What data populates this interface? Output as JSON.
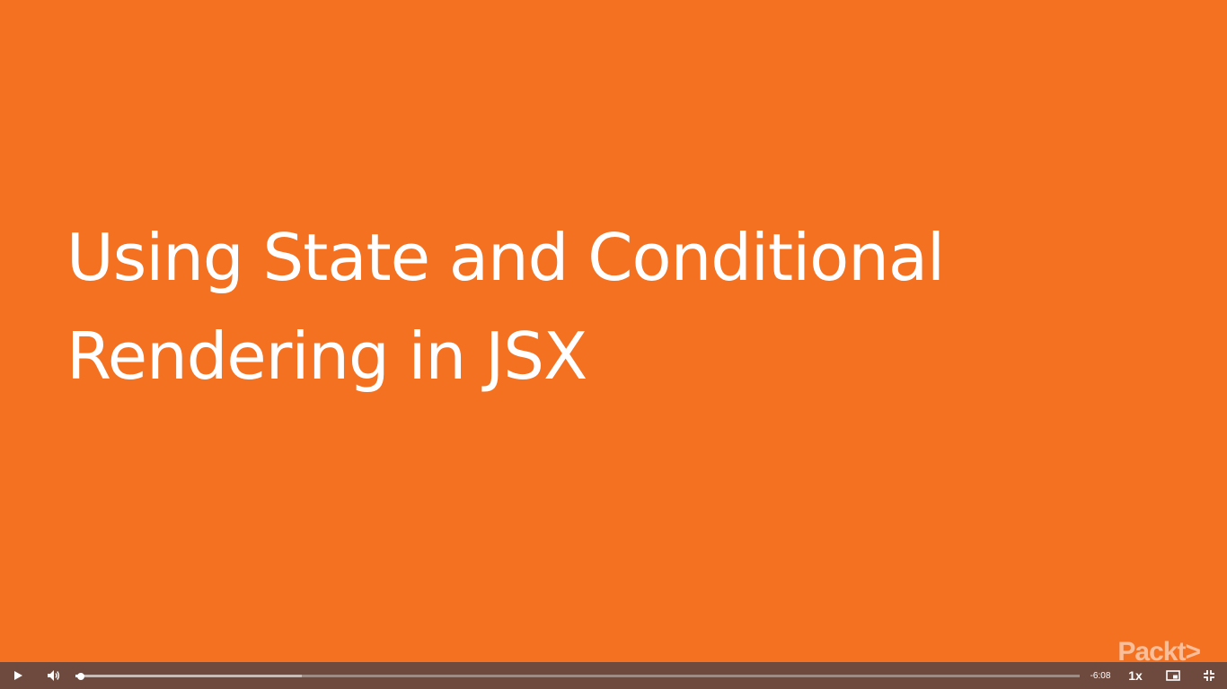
{
  "slide": {
    "title_lines": [
      "Using State and Conditional",
      "Rendering in JSX"
    ],
    "brand": "Packt>",
    "background_color": "#f37121"
  },
  "player": {
    "play_icon": "play-icon",
    "volume_icon": "volume-icon",
    "progress_fraction": 0.005,
    "buffered_fraction": 0.225,
    "time_remaining": "-6:08",
    "playback_speed": "1x",
    "pip_icon": "picture-in-picture-icon",
    "fullscreen_icon": "exit-fullscreen-icon",
    "bar_color": "#6e4a3e"
  }
}
